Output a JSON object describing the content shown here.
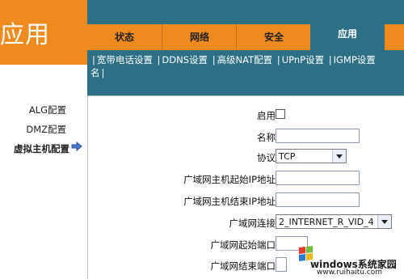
{
  "header": {
    "logo_text": "应用",
    "tabs": [
      {
        "label": "状态",
        "active": false
      },
      {
        "label": "网络",
        "active": false
      },
      {
        "label": "安全",
        "active": false
      },
      {
        "label": "应用",
        "active": true
      }
    ]
  },
  "subnav": {
    "items": [
      "宽带电话设置",
      "DDNS设置",
      "高级NAT配置",
      "UPnP设置",
      "IGMP设置"
    ],
    "line2": "名"
  },
  "sidebar": {
    "items": [
      {
        "label": "ALG配置",
        "active": false
      },
      {
        "label": "DMZ配置",
        "active": false
      },
      {
        "label": "虚拟主机配置",
        "active": true
      }
    ]
  },
  "form": {
    "enable_label": "启用",
    "name_label": "名称",
    "name_value": "",
    "protocol_label": "协议",
    "protocol_value": "TCP",
    "wan_start_ip_label": "广域网主机起始IP地址",
    "wan_start_ip_value": "",
    "wan_end_ip_label": "广域网主机结束IP地址",
    "wan_end_ip_value": "",
    "wan_conn_label": "广域网连接",
    "wan_conn_value": "2_INTERNET_R_VID_4",
    "wan_start_port_label": "广域网起始端口",
    "wan_end_port_label": "广域网结束端口"
  },
  "watermark": {
    "text": "windows系统家园",
    "url": "www.ruihaitu.com"
  },
  "colors": {
    "orange": "#ef8a1f",
    "teal": "#2d6f85"
  }
}
